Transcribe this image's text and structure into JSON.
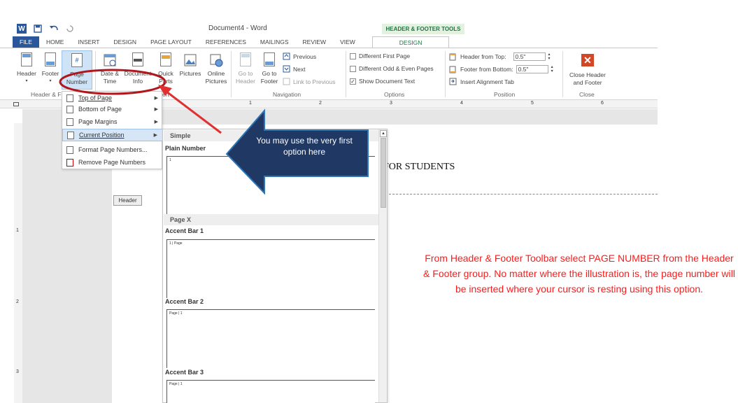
{
  "titlebar": {
    "doc_title": "Document4 - Word",
    "qat_icons": [
      "word-logo-icon",
      "save-icon",
      "undo-icon",
      "redo-icon"
    ],
    "word_logo_letter": "W",
    "contextual_label": "HEADER & FOOTER TOOLS"
  },
  "tabs": [
    "FILE",
    "HOME",
    "INSERT",
    "DESIGN",
    "PAGE LAYOUT",
    "REFERENCES",
    "MAILINGS",
    "REVIEW",
    "VIEW",
    "DESIGN"
  ],
  "ribbon": {
    "header_label": "Header",
    "footer_label": "Footer",
    "page_number_line1": "Page",
    "page_number_line2": "Number",
    "date_time_line1": "Date &",
    "date_time_line2": "Time",
    "doc_info_line1": "Document",
    "doc_info_line2": "Info",
    "quick_parts_line1": "Quick",
    "quick_parts_line2": "Parts",
    "pictures_label": "Pictures",
    "online_pictures_line1": "Online",
    "online_pictures_line2": "Pictures",
    "goto_header_line1": "Go to",
    "goto_header_line2": "Header",
    "goto_footer_line1": "Go to",
    "goto_footer_line2": "Footer",
    "previous_label": "Previous",
    "next_label": "Next",
    "link_to_previous_label": "Link to Previous",
    "different_first_page_label": "Different First Page",
    "different_odd_even_label": "Different Odd & Even Pages",
    "show_document_text_label": "Show Document Text",
    "show_document_text_checked": "✓",
    "header_from_top_label": "Header from Top:",
    "header_from_top_value": "0.5\"",
    "footer_from_bottom_label": "Footer from Bottom:",
    "footer_from_bottom_value": "0.5\"",
    "insert_alignment_tab_label": "Insert Alignment Tab",
    "close_line1": "Close Header",
    "close_line2": "and Footer",
    "groups": {
      "header_footer": "Header & F",
      "insert": "ert",
      "navigation": "Navigation",
      "options": "Options",
      "position": "Position",
      "close": "Close"
    }
  },
  "ruler": {
    "numbers": [
      "1",
      "2",
      "3",
      "4",
      "5",
      "6"
    ],
    "vnumbers": [
      "1",
      "2",
      "3"
    ]
  },
  "menu": {
    "items": [
      {
        "label": "Top of Page",
        "icon": "top-of-page-icon"
      },
      {
        "label": "Bottom of Page",
        "icon": "bottom-of-page-icon"
      },
      {
        "label": "Page Margins",
        "icon": "page-margins-icon"
      },
      {
        "label": "Current Position",
        "icon": "current-position-icon"
      },
      {
        "label": "Format Page Numbers...",
        "icon": "format-page-numbers-icon"
      },
      {
        "label": "Remove Page Numbers",
        "icon": "remove-page-numbers-icon"
      }
    ]
  },
  "gallery": {
    "sections": [
      {
        "title": "Simple",
        "items": [
          {
            "name": "Plain Number",
            "preview": "1"
          }
        ]
      },
      {
        "title": "Page X",
        "items": [
          {
            "name": "Accent Bar 1",
            "preview": "1 | Page"
          },
          {
            "name": "Accent Bar 2",
            "preview": "Page | 1"
          },
          {
            "name": "Accent Bar 3",
            "preview": "Page | 1"
          }
        ]
      }
    ]
  },
  "document": {
    "visible_text": "FOR STUDENTS",
    "header_tag": "Header"
  },
  "callout": {
    "text": "You may use the very first option here",
    "fill_color": "#1f3864",
    "arrow_color": "#e03030"
  },
  "annotation": {
    "text": "From Header & Footer Toolbar select PAGE NUMBER from the Header & Footer group.  No matter where the illustration is, the page number will be inserted where your cursor is resting using this option.",
    "color": "#ff1a1a"
  },
  "colors": {
    "word_blue": "#2b579a",
    "contextual_green": "#217346",
    "close_red": "#d24726"
  }
}
